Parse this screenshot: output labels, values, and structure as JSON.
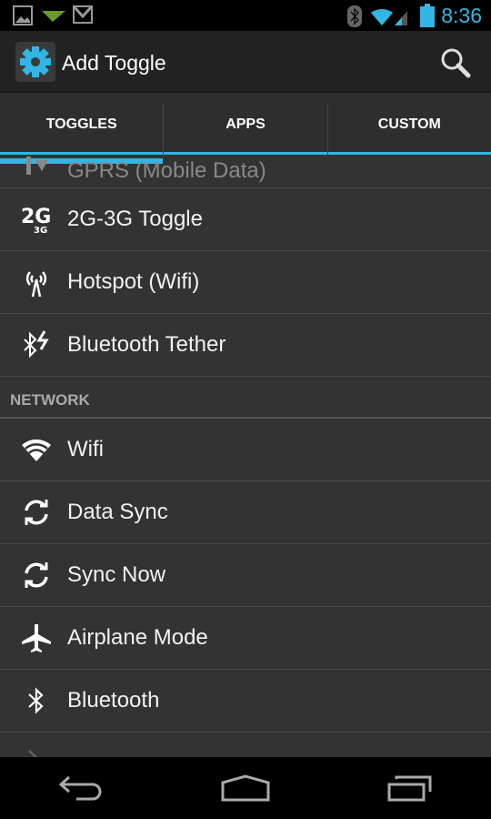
{
  "status_bar": {
    "time": "8:36",
    "icons": [
      "picture-icon",
      "airdroid-icon",
      "gmail-icon",
      "bluetooth-icon",
      "wifi-icon",
      "signal-icon",
      "battery-icon"
    ]
  },
  "action_bar": {
    "title": "Add Toggle",
    "icon": "gear-icon",
    "search_icon": "search-icon"
  },
  "tabs": [
    {
      "label": "TOGGLES",
      "active": true
    },
    {
      "label": "APPS",
      "active": false
    },
    {
      "label": "CUSTOM",
      "active": false
    }
  ],
  "accent": "#33b5e5",
  "list": {
    "group1": [
      {
        "label": "GPRS (Mobile Data)",
        "icon": "data-arrows-icon"
      },
      {
        "label": "2G-3G Toggle",
        "icon": "2g-3g-icon"
      },
      {
        "label": "Hotspot (Wifi)",
        "icon": "hotspot-icon"
      },
      {
        "label": "Bluetooth Tether",
        "icon": "bluetooth-tether-icon"
      }
    ],
    "section_network": "NETWORK",
    "group2": [
      {
        "label": "Wifi",
        "icon": "wifi-icon"
      },
      {
        "label": "Data Sync",
        "icon": "sync-icon"
      },
      {
        "label": "Sync Now",
        "icon": "sync-icon"
      },
      {
        "label": "Airplane Mode",
        "icon": "airplane-icon"
      },
      {
        "label": "Bluetooth",
        "icon": "bluetooth-icon"
      }
    ]
  },
  "nav_bar": [
    "back-icon",
    "home-icon",
    "recents-icon"
  ]
}
